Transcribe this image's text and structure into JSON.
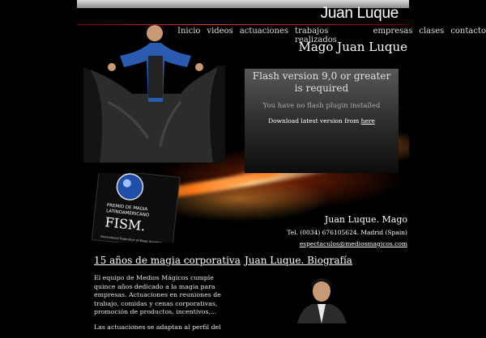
{
  "brand": "Juan Luque",
  "nav": [
    "Inicio",
    "videos",
    "actuaciones",
    "trabajos realizados",
    "empresas",
    "clases",
    "contacto"
  ],
  "page_title": "Mago Juan Luque",
  "flash": {
    "title": "Flash version 9,0 or greater is required",
    "subtitle": "You have no flash plugin installed",
    "download_text": "Download latest version from",
    "download_link": "here"
  },
  "award": {
    "line1": "PREMIO DE MAGIA",
    "line2": "LATINOAMERICANO",
    "name": "FISM.",
    "footer": "International Federation of Magic Societies"
  },
  "contact": {
    "name": "Juan Luque. Mago",
    "tel": "Tel. (0034) 676105624. Madrid (Spain)",
    "email": "espectaculos@mediosmagicos.com"
  },
  "section_corporate": {
    "title": "15 años de magia corporativa",
    "paragraph1": "El equipo de Medios Mágicos cumple quince años dedicado a la magia para empresas. Actuaciones en reuniones de trabajo, comidas y cenas corporativas, promoción de productos, incentivos,...",
    "paragraph2": "Las actuaciones se adaptan al perfil del"
  },
  "section_bio": {
    "title": "Juan Luque. Biografía"
  },
  "colors": {
    "accent": "#ff7a18",
    "background": "#000000"
  }
}
